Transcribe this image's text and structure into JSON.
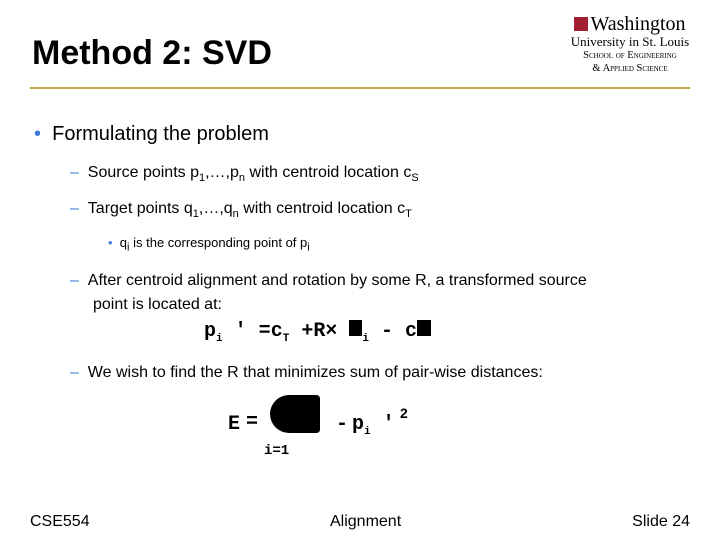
{
  "title": "Method 2: SVD",
  "logo": {
    "line1": "Washington",
    "line2": "University in St. Louis",
    "line3": "School of Engineering",
    "line4": "& Applied Science"
  },
  "bullets": {
    "main": "Formulating the problem",
    "source": {
      "text": "Source points p",
      "s1": "1",
      "mid": ",…,p",
      "s2": "n",
      "rest": " with centroid location c",
      "s3": "S"
    },
    "target": {
      "text": "Target points q",
      "s1": "1",
      "mid": ",…,q",
      "s2": "n",
      "rest": " with centroid location c",
      "s3": "T"
    },
    "sub": {
      "a": "q",
      "as": "i",
      "b": " is the corresponding point of p",
      "bs": "i"
    },
    "after": [
      "After centroid alignment and rotation by some R,  a transformed source",
      "point is located at:"
    ],
    "wish": "We wish to find the R that minimizes sum of pair-wise distances:"
  },
  "formula1": {
    "lhs": "p",
    "lhs_sub": "i",
    "prime": "'",
    "eq": "=",
    "c": "c",
    "c_sub": "T",
    "plus": "+",
    "R": "R",
    "times": "×",
    "p_sub": "i",
    "minus": "-",
    "c2": "c"
  },
  "formula2": {
    "E": "E",
    "eq": "=",
    "minus": "-",
    "p": "p",
    "p_sub": "i",
    "prime": "'",
    "sq": "2",
    "lower": "i=1"
  },
  "footer": {
    "left": "CSE554",
    "center": "Alignment",
    "right": "Slide 24"
  },
  "colors": {
    "accent": "#3a7bd5",
    "rule": "#c9a94a",
    "shield": "#a31f34"
  }
}
